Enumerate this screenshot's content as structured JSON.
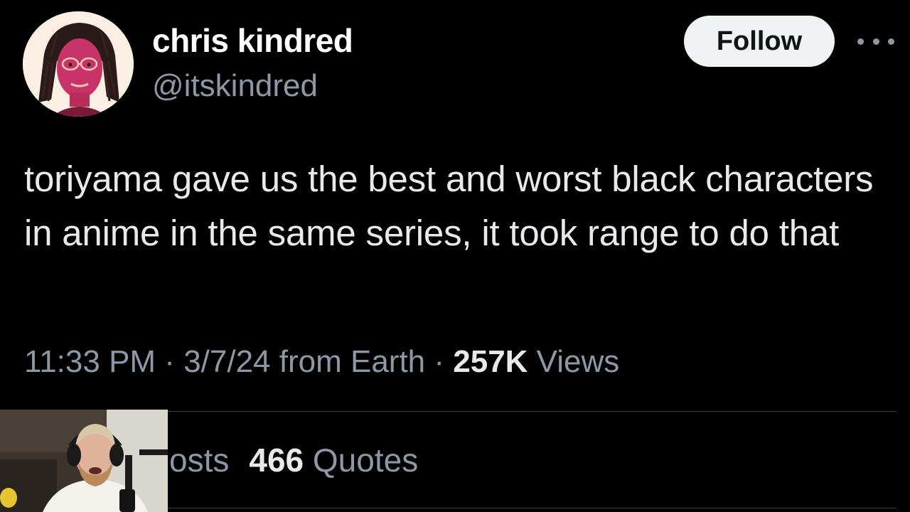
{
  "tweet": {
    "author": {
      "display_name": "chris kindred",
      "handle": "@itskindred",
      "avatar_icon": "illustrated-portrait-avatar"
    },
    "follow_label": "Follow",
    "more_icon": "more-horizontal-icon",
    "text": "toriyama gave us the best and worst black characters in anime in the same series, it took range to do that",
    "meta": {
      "time": "11:33 PM",
      "sep1": " · ",
      "date": "3/7/24",
      "source": " from Earth",
      "sep2": " · ",
      "views_count": "257K",
      "views_label": " Views"
    },
    "stats": {
      "reposts_label_partial": "osts",
      "quotes_count": "466",
      "quotes_label": " Quotes"
    }
  },
  "overlay": {
    "webcam_icon": "streamer-webcam-feed"
  },
  "colors": {
    "background": "#000000",
    "text_primary": "#e7e9ea",
    "text_secondary": "#8b98a5",
    "follow_bg": "#eff3f4",
    "divider": "#38444d"
  }
}
